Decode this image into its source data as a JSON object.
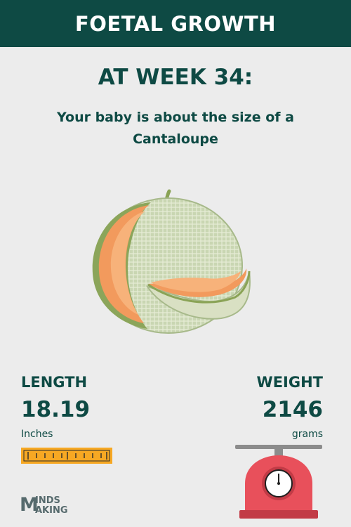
{
  "header": {
    "title": "FOETAL GROWTH"
  },
  "week": {
    "title": "AT WEEK 34:"
  },
  "size": {
    "line1": "Your baby is about the size of a",
    "line2": "Cantaloupe",
    "fruit_icon": "cantaloupe-illustration"
  },
  "length": {
    "label": "LENGTH",
    "value": "18.19",
    "unit": "Inches",
    "icon": "ruler-icon"
  },
  "weight": {
    "label": "WEIGHT",
    "value": "2146",
    "unit": "grams",
    "icon": "scale-icon"
  },
  "logo": {
    "initial": "M",
    "line1": "INDS",
    "line2": "AKING"
  },
  "colors": {
    "primary": "#0e4a44",
    "background": "#ececec",
    "ruler": "#f7a823",
    "scale": "#e8505b"
  }
}
